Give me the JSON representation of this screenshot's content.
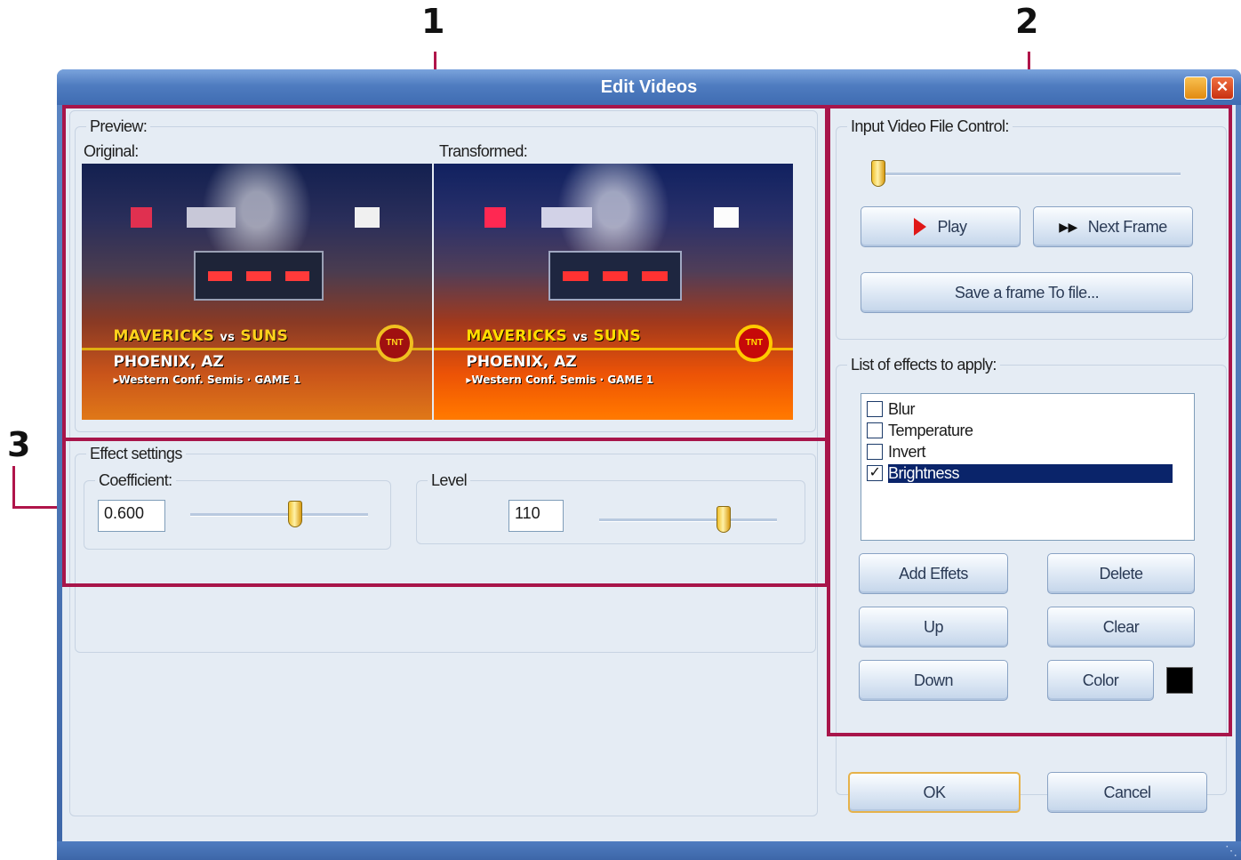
{
  "callouts": [
    "1",
    "2",
    "3"
  ],
  "window": {
    "title": "Edit Videos"
  },
  "preview": {
    "legend": "Preview:",
    "original_label": "Original:",
    "transformed_label": "Transformed:",
    "frame": {
      "line1a": "MAVERICKS",
      "line1b": "vs",
      "line1c": "SUNS",
      "line2": "PHOENIX, AZ",
      "line3": "▸Western Conf. Semis · GAME 1",
      "logo": "TNT"
    }
  },
  "effect_settings": {
    "legend": "Effect settings",
    "coefficient": {
      "legend": "Coefficient:",
      "value": "0.600",
      "slider_fraction": 0.6
    },
    "level": {
      "legend": "Level",
      "value": "110",
      "slider_fraction": 0.72
    }
  },
  "input_control": {
    "legend": "Input Video File Control:",
    "slider_fraction": 0.0,
    "play_label": "Play",
    "next_frame_label": "Next Frame",
    "save_frame_label": "Save a frame To file..."
  },
  "effects": {
    "legend": "List of effects to apply:",
    "items": [
      {
        "label": "Blur",
        "checked": false,
        "selected": false
      },
      {
        "label": "Temperature",
        "checked": false,
        "selected": false
      },
      {
        "label": "Invert",
        "checked": false,
        "selected": false
      },
      {
        "label": "Brightness",
        "checked": true,
        "selected": true
      }
    ],
    "add_label": "Add Effets",
    "delete_label": "Delete",
    "up_label": "Up",
    "clear_label": "Clear",
    "down_label": "Down",
    "color_label": "Color",
    "color_value": "#000000"
  },
  "footer": {
    "ok_label": "OK",
    "cancel_label": "Cancel"
  },
  "colors": {
    "highlight": "#a8154a",
    "selection": "#0a246a",
    "titlebar": "#4f7cc0"
  }
}
